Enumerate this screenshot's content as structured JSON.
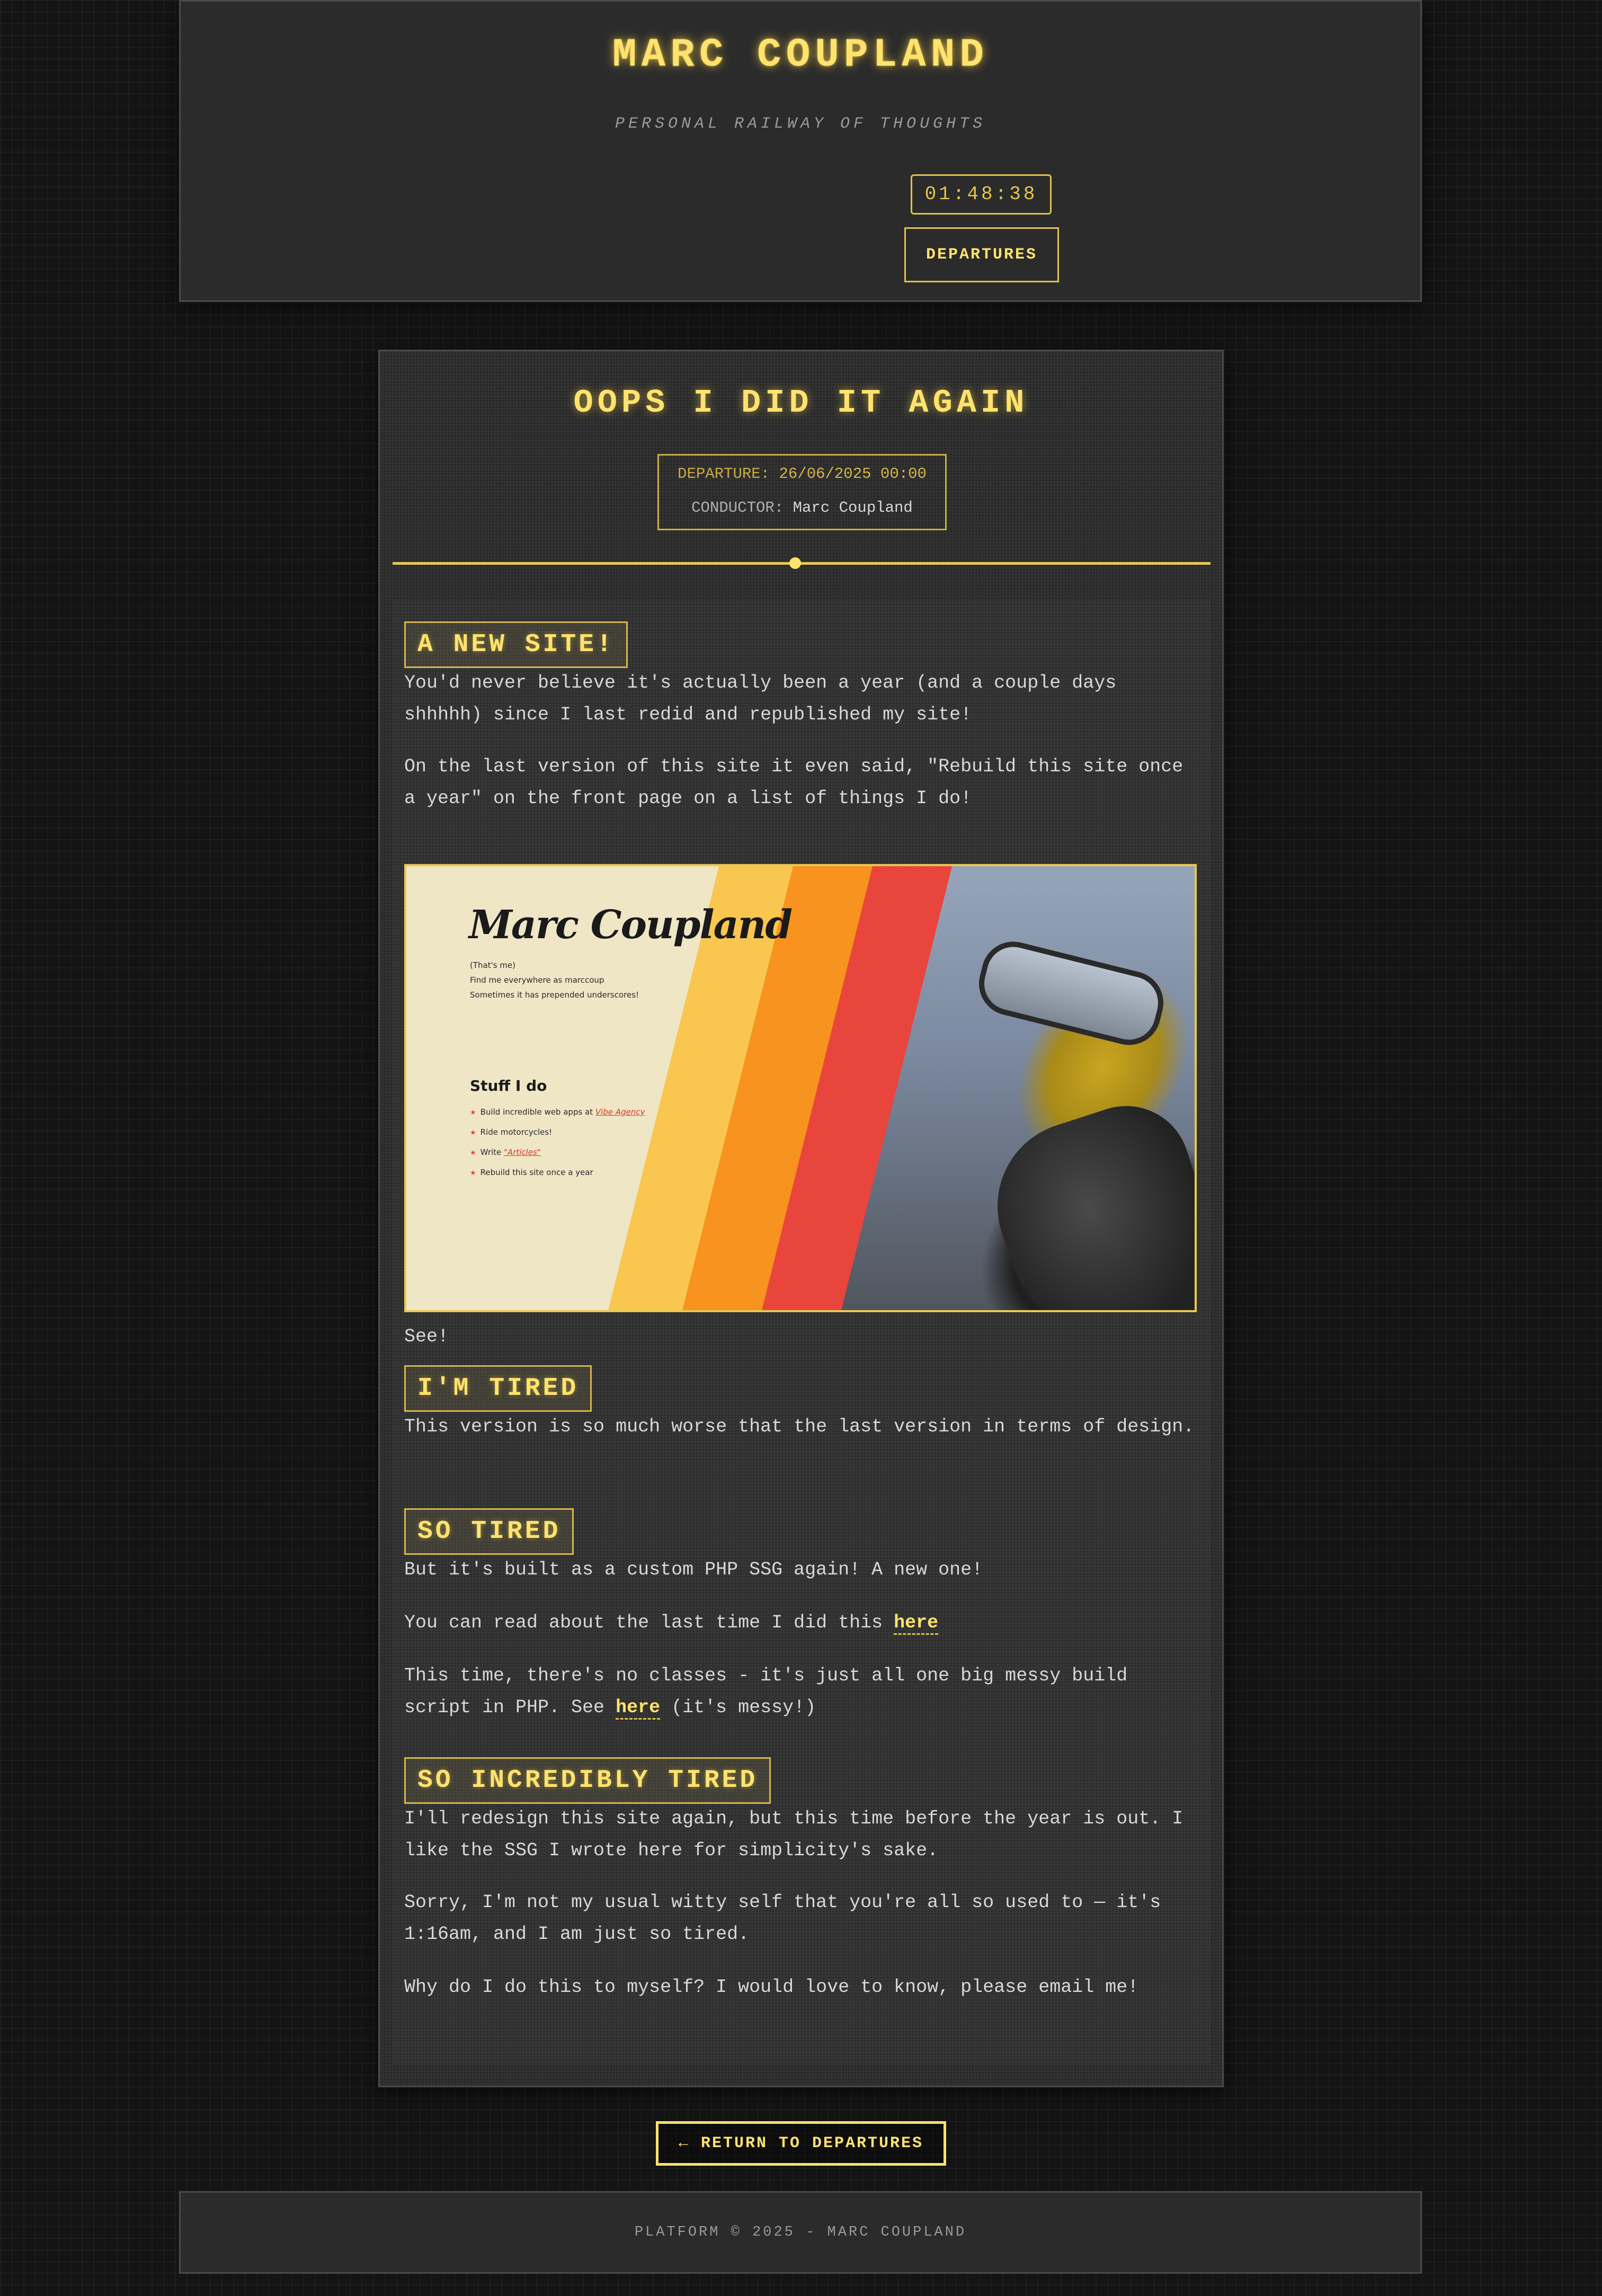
{
  "header": {
    "title": "MARC COUPLAND",
    "tagline": "PERSONAL RAILWAY OF THOUGHTS",
    "clock": "01:48:38",
    "nav_label": "DEPARTURES"
  },
  "post": {
    "title": "OOPS I DID IT AGAIN",
    "departure_label": "DEPARTURE:",
    "departure_value": "26/06/2025 00:00",
    "conductor_label": "CONDUCTOR:",
    "conductor_value": "Marc Coupland",
    "sections": [
      {
        "heading": "A NEW SITE!",
        "paragraphs": [
          "You'd never believe it's actually been a year (and a couple days shhhhh) since I last redid and republished my site!",
          "On the last version of this site it even said, \"Rebuild this site once a year\" on the front page on a list of things I do!"
        ]
      },
      {
        "after_image": "See!"
      },
      {
        "heading": "I'M TIRED",
        "paragraphs": [
          "This version is so much worse that the last version in terms of design."
        ]
      },
      {
        "heading": "SO TIRED",
        "paragraphs": [
          "But it's built as a custom PHP SSG again! A new one!"
        ],
        "link_para_1": {
          "text": "You can read about the last time I did this ",
          "link": "here"
        },
        "link_para_2": {
          "text_before": "This time, there's no classes - it's just all one big messy build script in PHP. See ",
          "link": "here",
          "text_after": " (it's messy!)"
        }
      },
      {
        "heading": "SO INCREDIBLY TIRED",
        "paragraphs": [
          "I'll redesign this site again, but this time before the year is out. I like the SSG I wrote here for simplicity's sake.",
          "Sorry, I'm not my usual witty self that you're all so used to — it's 1:16am, and I am just so tired.",
          "Why do I do this to myself? I would love to know, please email me!"
        ]
      }
    ],
    "image": {
      "name": "Marc Coupland",
      "lines": [
        "(That's me)",
        "Find me everywhere as marccoup",
        "Sometimes it has prepended underscores!"
      ],
      "stuff_heading": "Stuff I do",
      "stuff_items": [
        "Build incredible web apps at ",
        "Ride motorcycles!",
        "Write ",
        "Rebuild this site once a year"
      ],
      "stuff_links": [
        "Vibe Agency",
        "\"Articles\""
      ],
      "stripe_colors": [
        "#f9c74f",
        "#f7931e",
        "#e8453c"
      ]
    }
  },
  "footer": {
    "return_label": "← RETURN TO DEPARTURES",
    "copyright": "PLATFORM © 2025 - MARC COUPLAND"
  },
  "colors": {
    "accent": "#ffe36e",
    "background": "#141414",
    "panel": "#2b2b2b",
    "text": "#d8d8d8"
  }
}
